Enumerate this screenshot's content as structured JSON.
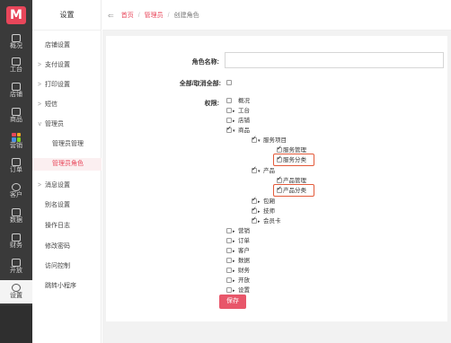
{
  "app": {
    "logo_letter": "M",
    "accent_color": "#e8465a"
  },
  "rail": {
    "items": [
      {
        "label": "概况",
        "icon": "monitor-icon"
      },
      {
        "label": "工台",
        "icon": "desk-icon"
      },
      {
        "label": "店铺",
        "icon": "store-icon"
      },
      {
        "label": "商品",
        "icon": "bag-icon"
      },
      {
        "label": "营销",
        "icon": "apps-grid-icon"
      },
      {
        "label": "订单",
        "icon": "order-icon"
      },
      {
        "label": "客户",
        "icon": "user-icon"
      },
      {
        "label": "数据",
        "icon": "chart-icon"
      },
      {
        "label": "财务",
        "icon": "wallet-icon"
      },
      {
        "label": "开放",
        "icon": "open-icon"
      },
      {
        "label": "设置",
        "icon": "gear-icon"
      }
    ]
  },
  "sidebar": {
    "title": "设置",
    "items": [
      {
        "label": "店铺设置",
        "caret": ""
      },
      {
        "label": "支付设置",
        "caret": ">"
      },
      {
        "label": "打印设置",
        "caret": ">"
      },
      {
        "label": "短信",
        "caret": ">"
      },
      {
        "label": "管理员",
        "caret": "v"
      },
      {
        "label": "管理员管理",
        "caret": ""
      },
      {
        "label": "管理员角色",
        "caret": ""
      },
      {
        "label": "消息设置",
        "caret": ">"
      },
      {
        "label": "别名设置",
        "caret": ""
      },
      {
        "label": "操作日志",
        "caret": ""
      },
      {
        "label": "修改密码",
        "caret": ""
      },
      {
        "label": "访问控制",
        "caret": ""
      },
      {
        "label": "跳转小程序",
        "caret": ""
      }
    ]
  },
  "breadcrumb": {
    "back": "⇐",
    "home": "首页",
    "section": "管理员",
    "current": "创建角色",
    "separator": "/"
  },
  "form": {
    "role_name_label": "角色名称:",
    "role_name_value": "",
    "select_all_label": "全部/取消全部:",
    "permissions_label": "权限:",
    "save_label": "保存"
  },
  "permissions": [
    {
      "label": "概况",
      "checked": false,
      "arrow": ""
    },
    {
      "label": "工台",
      "checked": false,
      "arrow": "▸"
    },
    {
      "label": "店铺",
      "checked": false,
      "arrow": "▸"
    },
    {
      "label": "商品",
      "checked": true,
      "arrow": "▾"
    },
    {
      "label": "服务项目",
      "checked": true,
      "arrow": "▾"
    },
    {
      "label": "服务管理",
      "checked": true,
      "arrow": ""
    },
    {
      "label": "服务分类",
      "checked": true,
      "arrow": ""
    },
    {
      "label": "产品",
      "checked": true,
      "arrow": "▾"
    },
    {
      "label": "产品管理",
      "checked": true,
      "arrow": ""
    },
    {
      "label": "产品分类",
      "checked": true,
      "arrow": ""
    },
    {
      "label": "包厢",
      "checked": true,
      "arrow": "▸"
    },
    {
      "label": "技师",
      "checked": true,
      "arrow": "▸"
    },
    {
      "label": "会员卡",
      "checked": true,
      "arrow": "▸"
    },
    {
      "label": "营销",
      "checked": false,
      "arrow": "▸"
    },
    {
      "label": "订单",
      "checked": false,
      "arrow": "▸"
    },
    {
      "label": "客户",
      "checked": false,
      "arrow": "▸"
    },
    {
      "label": "数据",
      "checked": false,
      "arrow": "▸"
    },
    {
      "label": "财务",
      "checked": false,
      "arrow": "▸"
    },
    {
      "label": "开放",
      "checked": false,
      "arrow": "▸"
    },
    {
      "label": "设置",
      "checked": false,
      "arrow": "▸"
    }
  ]
}
